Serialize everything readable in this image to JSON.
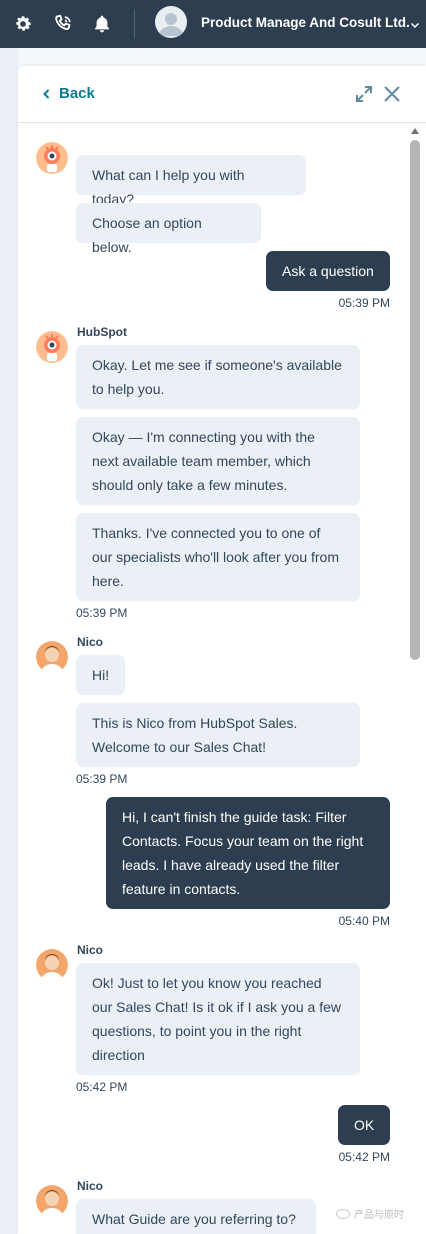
{
  "topbar": {
    "company": "Product Manage And Cosult Ltd.",
    "icons": [
      "gear-icon",
      "phone-icon",
      "bell-icon"
    ],
    "bg_color": "#2d3e50"
  },
  "header": {
    "back_label": "Back"
  },
  "conversation": {
    "m1": "What can I help you with today?",
    "m2": "Choose an option below.",
    "m3": "Ask a question",
    "t1": "05:39 PM",
    "sender_bot": "HubSpot",
    "m4": "Okay. Let me see if someone's available to help you.",
    "m5": "Okay — I'm connecting you with the next available team member, which should only take a few minutes.",
    "m6": "Thanks. I've connected you to one of our specialists who'll look after you from here.",
    "t2": "05:39 PM",
    "sender_nico_1": "Nico",
    "m7": "Hi!",
    "m8": "This is Nico from HubSpot Sales. Welcome to our Sales Chat!",
    "t3": "05:39 PM",
    "m9": "Hi, I can't finish the guide task: Filter Contacts. Focus your team on the right leads. I have already used the filter feature in contacts.",
    "t4": "05:40 PM",
    "sender_nico_2": "Nico",
    "m10": "Ok! Just to let you know you reached our Sales Chat! Is it ok if I ask you a few questions, to point you in the right direction",
    "t5": "05:42 PM",
    "m11": "OK",
    "t6": "05:42 PM",
    "sender_nico_3": "Nico",
    "m12": "What Guide are you referring to?"
  },
  "colors": {
    "accent": "#0b7a95",
    "user_bubble": "#2d3e50",
    "agent_bubble": "#eaf0f6",
    "text": "#33475b"
  },
  "watermark": "产品与原时"
}
